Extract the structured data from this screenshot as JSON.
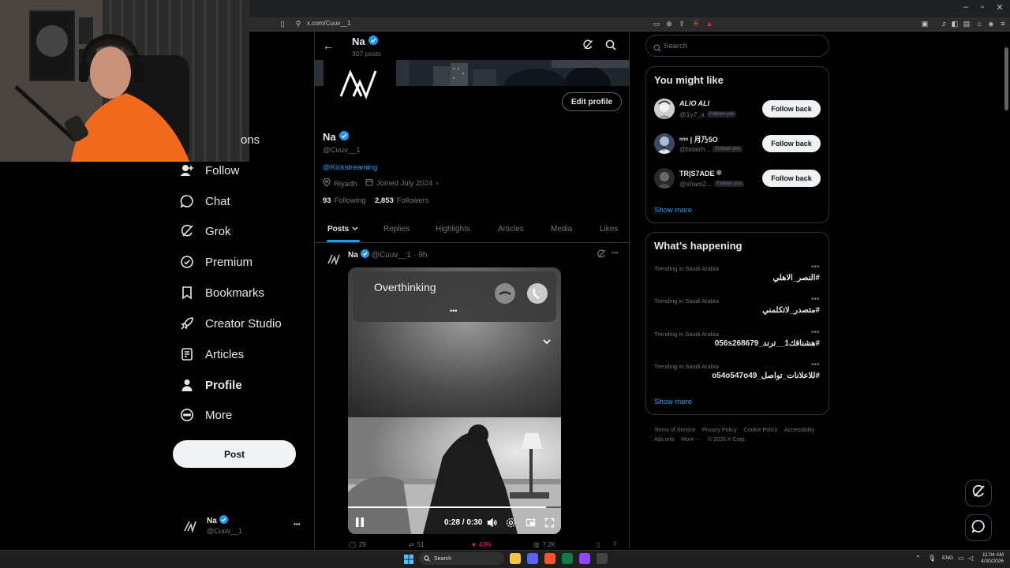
{
  "browser": {
    "url": "x.com/Cuuv__1",
    "window_controls": [
      "–",
      "▫",
      "✕"
    ]
  },
  "nav": {
    "partial_item": "ons",
    "items": [
      {
        "label": "Follow",
        "icon": "person-plus-icon"
      },
      {
        "label": "Chat",
        "icon": "chat-bubble-icon"
      },
      {
        "label": "Grok",
        "icon": "grok-icon"
      },
      {
        "label": "Premium",
        "icon": "verified-badge-icon"
      },
      {
        "label": "Bookmarks",
        "icon": "bookmark-icon"
      },
      {
        "label": "Creator Studio",
        "icon": "rocket-icon"
      },
      {
        "label": "Articles",
        "icon": "article-icon"
      },
      {
        "label": "Profile",
        "icon": "person-icon"
      },
      {
        "label": "More",
        "icon": "more-circle-icon"
      }
    ],
    "post_button": "Post",
    "account": {
      "name": "Na",
      "handle": "@Cuuv__1",
      "more": "•••"
    }
  },
  "profile": {
    "header_name": "Na",
    "post_count": "307 posts",
    "edit_profile": "Edit profile",
    "name": "Na",
    "handle": "@Cuuv__1",
    "link": "@Kickstreaming",
    "location": "Riyadh",
    "joined": "Joined July 2024",
    "following_count": "93",
    "following_label": "Following",
    "followers_count": "2,853",
    "followers_label": "Followers"
  },
  "tabs": [
    "Posts",
    "Replies",
    "Highlights",
    "Articles",
    "Media",
    "Likes"
  ],
  "post": {
    "author": "Na",
    "handle": "@Cuuv__1",
    "dot": "·",
    "time": "9h",
    "more": "•••",
    "video": {
      "call_title": "Overthinking",
      "call_dots": "•••",
      "time_display": "0:28 / 0:30",
      "progress": 0.93
    },
    "stats": {
      "replies": "29",
      "reposts": "51",
      "likes": "43%",
      "views": "7.2K"
    }
  },
  "right": {
    "search_placeholder": "Search",
    "might_like": {
      "title": "You might like",
      "users": [
        {
          "name": "ALIO ALI",
          "handle": "@1y7_a",
          "badge": "Follows you",
          "button": "Follow back"
        },
        {
          "name": "ᵒᵒᵒ | 月乃5O",
          "handle": "@bdalrh...",
          "badge": "Follows you",
          "button": "Follow back"
        },
        {
          "name": "TR|S7ADE",
          "handle": "@sham2...",
          "badge": "Follows you",
          "button": "Follow back"
        }
      ],
      "show_more": "Show more"
    },
    "happening": {
      "title": "What’s happening",
      "trends": [
        {
          "meta": "Trending in Saudi Arabia",
          "tag": "#النصر_الاهلي"
        },
        {
          "meta": "Trending in Saudi Arabia",
          "tag": "#متصدر_لاتكلمني"
        },
        {
          "meta": "Trending in Saudi Arabia",
          "tag": "#هشناقك1__ترند_056s268679"
        },
        {
          "meta": "Trending in Saudi Arabia",
          "tag": "#للاعلانات_تواصل_o54o547o49"
        }
      ],
      "show_more": "Show more"
    },
    "footer": [
      "Terms of Service",
      "Privacy Policy",
      "Cookie Policy",
      "Accessibility",
      "Ads info",
      "More ···",
      "© 2026 X Corp."
    ]
  },
  "taskbar": {
    "search": "Search",
    "lang": "ENG",
    "time": "11:04 AM",
    "date": "4/30/2026"
  }
}
